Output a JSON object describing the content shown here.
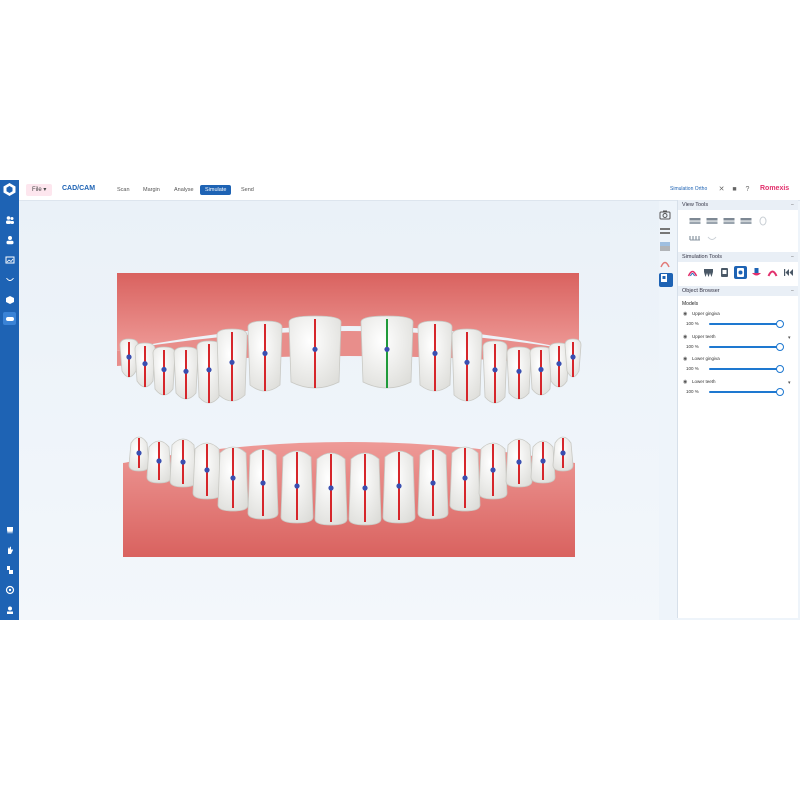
{
  "topbar": {
    "file_label": "File",
    "app_title": "CAD/CAM",
    "tabs": [
      {
        "label": "Scan"
      },
      {
        "label": "Margin"
      },
      {
        "label": "Analyse"
      },
      {
        "label": "Simulate",
        "active": true
      },
      {
        "label": "Send"
      }
    ],
    "right_label": "Simulation Ortho",
    "brand": "Romexis"
  },
  "panel": {
    "view_tools": {
      "title": "View Tools"
    },
    "simulation_tools": {
      "title": "Simulation Tools",
      "active_index": 3
    },
    "object_browser": {
      "title": "Object Browser",
      "models_label": "Models",
      "models": [
        {
          "name": "Upper gingiva",
          "value": 100,
          "value_label": "100 %"
        },
        {
          "name": "Upper teeth",
          "value": 100,
          "value_label": "100 %"
        },
        {
          "name": "Lower gingiva",
          "value": 100,
          "value_label": "100 %"
        },
        {
          "name": "Lower teeth",
          "value": 100,
          "value_label": "100 %"
        }
      ]
    }
  },
  "viewport": {
    "highlight_tooth_index": 8
  },
  "colors": {
    "accent": "#1e63b4",
    "brand": "#e2306c",
    "gingiva": "#e27a78",
    "tooth": "#f6f6f4",
    "axis": "#d6262b",
    "axis_highlight": "#1f9a3a"
  }
}
